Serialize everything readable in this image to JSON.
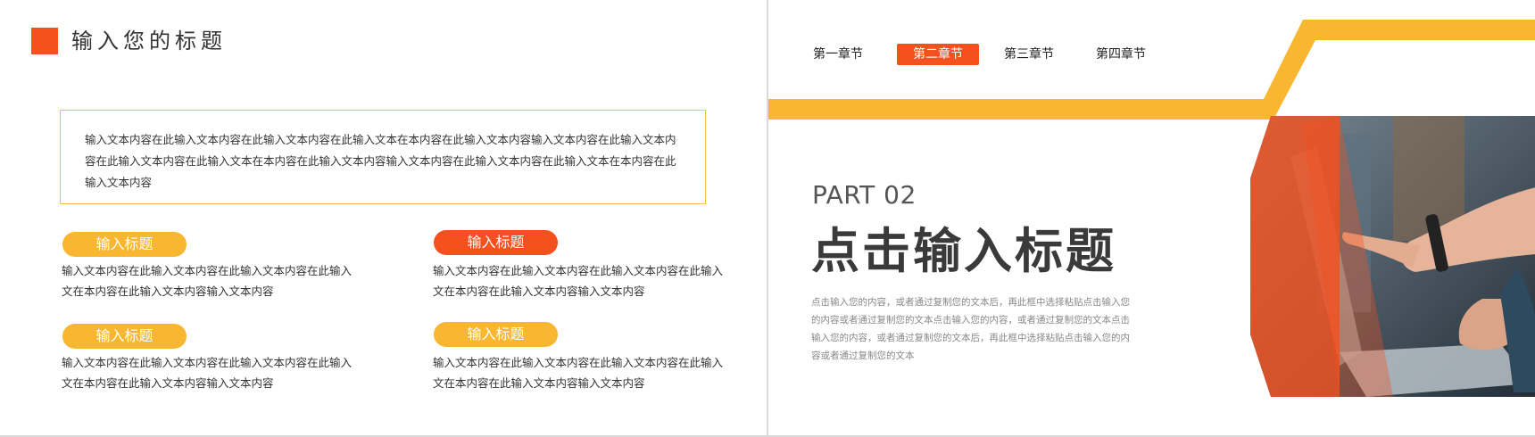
{
  "left": {
    "title": "输入您的标题",
    "intro": "输入文本内容在此输入文本内容在此输入文本内容在此输入文本在本内容在此输入文本内容输入文本内容在此输入文本内容在此输入文本内容在此输入文本在本内容在此输入文本内容输入文本内容在此输入文本内容在此输入文本在本内容在此输入文本内容",
    "items": [
      {
        "label": "输入标题",
        "text": "输入文本内容在此输入文本内容在此输入文本内容在此输入文在本内容在此输入文本内容输入文本内容"
      },
      {
        "label": "输入标题",
        "text": "输入文本内容在此输入文本内容在此输入文本内容在此输入文在本内容在此输入文本内容输入文本内容"
      },
      {
        "label": "输入标题",
        "text": "输入文本内容在此输入文本内容在此输入文本内容在此输入文在本内容在此输入文本内容输入文本内容"
      },
      {
        "label": "输入标题",
        "text": "输入文本内容在此输入文本内容在此输入文本内容在此输入文在本内容在此输入文本内容输入文本内容"
      }
    ]
  },
  "right": {
    "nav": [
      "第一章节",
      "第二章节",
      "第三章节",
      "第四章节"
    ],
    "active_nav": "第二章节",
    "part": "PART 02",
    "title": "点击输入标题",
    "description": "点击输入您的内容，或者通过复制您的文本后，再此框中选择粘贴点击输入您的内容或者通过复制您的文本点击输入您的内容，或者通过复制您的文本点击输入您的内容，或者通过复制您的文本后，再此框中选择粘贴点击输入您的内容或者通过复制您的文本"
  },
  "colors": {
    "orange": "#f4511e",
    "yellow": "#f9b630",
    "border_yellow": "#f6c04a",
    "text_dark": "#333333",
    "text_grey": "#888888"
  }
}
